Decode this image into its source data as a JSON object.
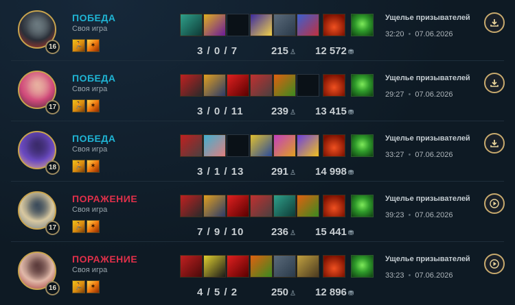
{
  "matches": [
    {
      "level": "16",
      "result": "ПОБЕДА",
      "result_type": "win",
      "mode": "Своя игра",
      "kda": "3 / 0 / 7",
      "cs": "215",
      "gold": "12 572",
      "map": "Ущелье призывателей",
      "duration": "32:20",
      "date": "07.06.2026",
      "action": "download-icon",
      "portrait_colors": [
        "#2a2f38",
        "#c0382a",
        "#6c7a80"
      ],
      "items": [
        {
          "empty": false,
          "colors": [
            "#2fa08a",
            "#0e3a36"
          ]
        },
        {
          "empty": false,
          "colors": [
            "#e0b020",
            "#6a1a9a"
          ]
        },
        {
          "empty": true
        },
        {
          "empty": false,
          "colors": [
            "#3a2aa0",
            "#f0d04a"
          ]
        },
        {
          "empty": false,
          "colors": [
            "#5a6a7a",
            "#2a3a4a"
          ]
        },
        {
          "empty": false,
          "colors": [
            "#3a60d0",
            "#c03040"
          ]
        }
      ],
      "trinket_colors": [
        "#f05020",
        "#7a1000"
      ]
    },
    {
      "level": "17",
      "result": "ПОБЕДА",
      "result_type": "win",
      "mode": "Своя игра",
      "kda": "3 / 0 / 11",
      "cs": "239",
      "gold": "13 415",
      "map": "Ущелье призывателей",
      "duration": "29:27",
      "date": "07.06.2026",
      "action": "download-icon",
      "portrait_colors": [
        "#d04a7a",
        "#4a2a3a",
        "#e8b0a0"
      ],
      "items": [
        {
          "empty": false,
          "colors": [
            "#c02020",
            "#2a2a2a"
          ]
        },
        {
          "empty": false,
          "colors": [
            "#e0a020",
            "#2a3a6a"
          ]
        },
        {
          "empty": false,
          "colors": [
            "#e02020",
            "#5a0000"
          ]
        },
        {
          "empty": false,
          "colors": [
            "#c03030",
            "#4a4040"
          ]
        },
        {
          "empty": false,
          "colors": [
            "#e06010",
            "#3a8a20"
          ]
        },
        {
          "empty": true
        }
      ],
      "trinket_colors": [
        "#f05020",
        "#7a1000"
      ]
    },
    {
      "level": "18",
      "result": "ПОБЕДА",
      "result_type": "win",
      "mode": "Своя игра",
      "kda": "3 / 1 / 13",
      "cs": "291",
      "gold": "14 998",
      "map": "Ущелье призывателей",
      "duration": "33:27",
      "date": "07.06.2026",
      "action": "download-icon",
      "portrait_colors": [
        "#6a4ac0",
        "#e8b088",
        "#3a2a6a"
      ],
      "items": [
        {
          "empty": false,
          "colors": [
            "#c02020",
            "#4a4040"
          ]
        },
        {
          "empty": false,
          "colors": [
            "#40b0d0",
            "#e08080"
          ]
        },
        {
          "empty": true
        },
        {
          "empty": false,
          "colors": [
            "#e0c030",
            "#2a4a9a"
          ]
        },
        {
          "empty": false,
          "colors": [
            "#c040c0",
            "#e0a020"
          ]
        },
        {
          "empty": false,
          "colors": [
            "#6a40e0",
            "#f0c020"
          ]
        }
      ],
      "trinket_colors": [
        "#f05020",
        "#7a1000"
      ]
    },
    {
      "level": "17",
      "result": "ПОРАЖЕНИЕ",
      "result_type": "loss",
      "mode": "Своя игра",
      "kda": "7 / 9 / 10",
      "cs": "236",
      "gold": "15 441",
      "map": "Ущелье призывателей",
      "duration": "39:23",
      "date": "07.06.2026",
      "action": "replay-icon",
      "portrait_colors": [
        "#d8c8a0",
        "#6a7a8a",
        "#3a4a5a"
      ],
      "items": [
        {
          "empty": false,
          "colors": [
            "#c02020",
            "#2a2a2a"
          ]
        },
        {
          "empty": false,
          "colors": [
            "#e0a020",
            "#2a3a6a"
          ]
        },
        {
          "empty": false,
          "colors": [
            "#e02020",
            "#5a0000"
          ]
        },
        {
          "empty": false,
          "colors": [
            "#c03030",
            "#4a4040"
          ]
        },
        {
          "empty": false,
          "colors": [
            "#2fa08a",
            "#0e3a36"
          ]
        },
        {
          "empty": false,
          "colors": [
            "#e06010",
            "#3a8a20"
          ]
        }
      ],
      "trinket_colors": [
        "#f05020",
        "#7a1000"
      ]
    },
    {
      "level": "16",
      "result": "ПОРАЖЕНИЕ",
      "result_type": "loss",
      "mode": "Своя игра",
      "kda": "4 / 5 / 2",
      "cs": "250",
      "gold": "12 896",
      "map": "Ущелье призывателей",
      "duration": "33:23",
      "date": "07.06.2026",
      "action": "replay-icon",
      "portrait_colors": [
        "#e0b8a8",
        "#a03030",
        "#5a3a3a"
      ],
      "items": [
        {
          "empty": false,
          "colors": [
            "#c02020",
            "#4a0a0a"
          ]
        },
        {
          "empty": false,
          "colors": [
            "#e0d030",
            "#1a1a1a"
          ]
        },
        {
          "empty": false,
          "colors": [
            "#e02020",
            "#5a0000"
          ]
        },
        {
          "empty": false,
          "colors": [
            "#e06010",
            "#3a8a20"
          ]
        },
        {
          "empty": false,
          "colors": [
            "#5a6a7a",
            "#2a3a4a"
          ]
        },
        {
          "empty": false,
          "colors": [
            "#c0a040",
            "#4a3a20"
          ]
        }
      ],
      "trinket_colors": [
        "#f05020",
        "#7a1000"
      ]
    }
  ]
}
